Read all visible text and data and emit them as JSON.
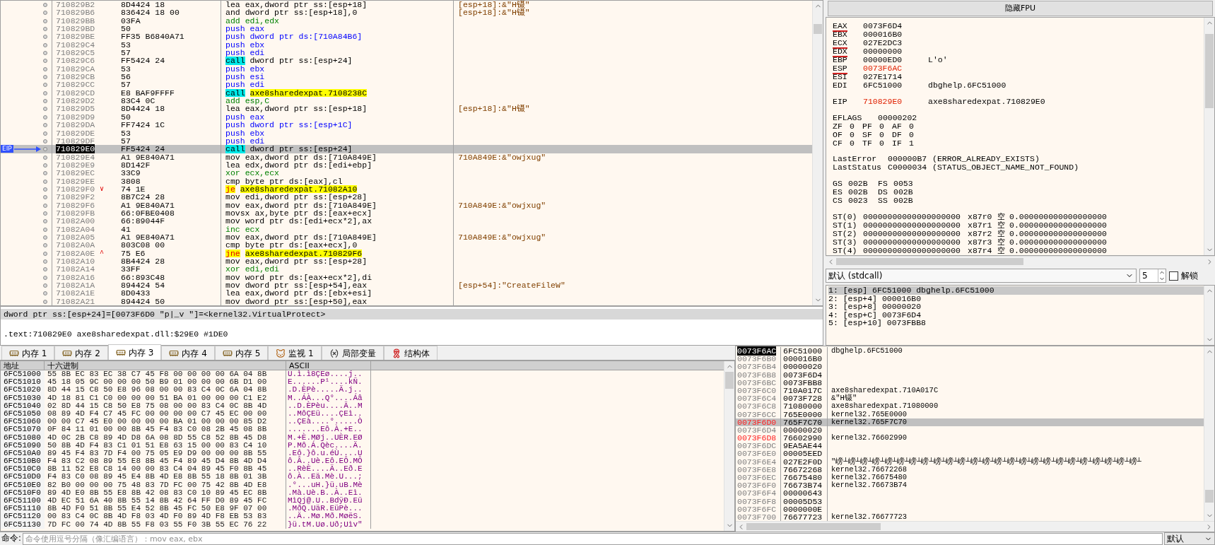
{
  "disassembly": {
    "rows": [
      {
        "address": "710829B2",
        "bytes": "8D4424 18",
        "mnemonic": "lea",
        "operands": "eax,dword ptr ss:[esp+18]",
        "kind": "move",
        "comment": "[esp+18]:&\"H镊\"",
        "selected": false
      },
      {
        "address": "710829B6",
        "bytes": "836424 18 00",
        "mnemonic": "and",
        "operands": "dword ptr ss:[esp+18],0",
        "kind": "move",
        "comment": "[esp+18]:&\"H镊\"",
        "selected": false
      },
      {
        "address": "710829BB",
        "bytes": "03FA",
        "mnemonic": "add",
        "operands": "edi,edx",
        "kind": "arith",
        "selected": false
      },
      {
        "address": "710829BD",
        "bytes": "50",
        "mnemonic": "push",
        "operands": "eax",
        "kind": "push",
        "selected": false
      },
      {
        "address": "710829BE",
        "bytes": "FF35 B6840A71",
        "mnemonic": "push",
        "operands": "dword ptr ds:[710A84B6]",
        "kind": "push",
        "selected": false
      },
      {
        "address": "710829C4",
        "bytes": "53",
        "mnemonic": "push",
        "operands": "ebx",
        "kind": "push",
        "selected": false
      },
      {
        "address": "710829C5",
        "bytes": "57",
        "mnemonic": "push",
        "operands": "edi",
        "kind": "push",
        "selected": false
      },
      {
        "address": "710829C6",
        "bytes": "FF5424 24",
        "mnemonic": "call",
        "operands": "dword ptr ss:[esp+24]",
        "kind": "call",
        "selected": false
      },
      {
        "address": "710829CA",
        "bytes": "53",
        "mnemonic": "push",
        "operands": "ebx",
        "kind": "push",
        "selected": false
      },
      {
        "address": "710829CB",
        "bytes": "56",
        "mnemonic": "push",
        "operands": "esi",
        "kind": "push",
        "selected": false
      },
      {
        "address": "710829CC",
        "bytes": "57",
        "mnemonic": "push",
        "operands": "edi",
        "kind": "push",
        "selected": false
      },
      {
        "address": "710829CD",
        "bytes": "E8 BAF9FFFF",
        "mnemonic": "call",
        "operands": "axe8sharedexpat.7108238C",
        "kind": "call_label",
        "selected": false
      },
      {
        "address": "710829D2",
        "bytes": "83C4 0C",
        "mnemonic": "add",
        "operands": "esp,C",
        "kind": "arith",
        "selected": false
      },
      {
        "address": "710829D5",
        "bytes": "8D4424 18",
        "mnemonic": "lea",
        "operands": "eax,dword ptr ss:[esp+18]",
        "kind": "move",
        "comment": "[esp+18]:&\"H镊\"",
        "selected": false
      },
      {
        "address": "710829D9",
        "bytes": "50",
        "mnemonic": "push",
        "operands": "eax",
        "kind": "push",
        "selected": false
      },
      {
        "address": "710829DA",
        "bytes": "FF7424 1C",
        "mnemonic": "push",
        "operands": "dword ptr ss:[esp+1C]",
        "kind": "push",
        "selected": false
      },
      {
        "address": "710829DE",
        "bytes": "53",
        "mnemonic": "push",
        "operands": "ebx",
        "kind": "push",
        "selected": false
      },
      {
        "address": "710829DF",
        "bytes": "57",
        "mnemonic": "push",
        "operands": "edi",
        "kind": "push",
        "selected": false
      },
      {
        "address": "710829E0",
        "bytes": "FF5424 24",
        "mnemonic": "call",
        "operands": "dword ptr ss:[esp+24]",
        "kind": "call",
        "eip_label": "EIP",
        "selected": true
      },
      {
        "address": "710829E4",
        "bytes": "A1 9E840A71",
        "mnemonic": "mov",
        "operands": "eax,dword ptr ds:[710A849E]",
        "kind": "move",
        "comment": "710A849E:&\"owjxug\"",
        "selected": false
      },
      {
        "address": "710829E9",
        "bytes": "8D142F",
        "mnemonic": "lea",
        "operands": "edx,dword ptr ds:[edi+ebp]",
        "kind": "move",
        "selected": false
      },
      {
        "address": "710829EC",
        "bytes": "33C9",
        "mnemonic": "xor",
        "operands": "ecx,ecx",
        "kind": "arith",
        "selected": false
      },
      {
        "address": "710829EE",
        "bytes": "3808",
        "mnemonic": "cmp",
        "operands": "byte ptr ds:[eax],cl",
        "kind": "move",
        "selected": false
      },
      {
        "address": "710829F0",
        "bytes": "74 1E",
        "mnemonic": "je",
        "operands": "axe8sharedexpat.71082A10",
        "kind": "jump",
        "branch_mark": "∨",
        "selected": false
      },
      {
        "address": "710829F2",
        "bytes": "8B7C24 28",
        "mnemonic": "mov",
        "operands": "edi,dword ptr ss:[esp+28]",
        "kind": "move",
        "selected": false
      },
      {
        "address": "710829F6",
        "bytes": "A1 9E840A71",
        "mnemonic": "mov",
        "operands": "eax,dword ptr ds:[710A849E]",
        "kind": "move",
        "comment": "710A849E:&\"owjxug\"",
        "selected": false
      },
      {
        "address": "710829FB",
        "bytes": "66:0FBE0408",
        "mnemonic": "movsx",
        "operands": "ax,byte ptr ds:[eax+ecx]",
        "kind": "move",
        "selected": false
      },
      {
        "address": "71082A00",
        "bytes": "66:89044F",
        "mnemonic": "mov",
        "operands": "word ptr ds:[edi+ecx*2],ax",
        "kind": "move",
        "selected": false
      },
      {
        "address": "71082A04",
        "bytes": "41",
        "mnemonic": "inc",
        "operands": "ecx",
        "kind": "arith",
        "selected": false
      },
      {
        "address": "71082A05",
        "bytes": "A1 9E840A71",
        "mnemonic": "mov",
        "operands": "eax,dword ptr ds:[710A849E]",
        "kind": "move",
        "comment": "710A849E:&\"owjxug\"",
        "selected": false
      },
      {
        "address": "71082A0A",
        "bytes": "803C08 00",
        "mnemonic": "cmp",
        "operands": "byte ptr ds:[eax+ecx],0",
        "kind": "move",
        "selected": false
      },
      {
        "address": "71082A0E",
        "bytes": "75 E6",
        "mnemonic": "jne",
        "operands": "axe8sharedexpat.710829F6",
        "kind": "jump",
        "branch_mark": "^",
        "selected": false
      },
      {
        "address": "71082A10",
        "bytes": "8B4424 28",
        "mnemonic": "mov",
        "operands": "eax,dword ptr ss:[esp+28]",
        "kind": "move",
        "selected": false
      },
      {
        "address": "71082A14",
        "bytes": "33FF",
        "mnemonic": "xor",
        "operands": "edi,edi",
        "kind": "arith",
        "selected": false
      },
      {
        "address": "71082A16",
        "bytes": "66:893C48",
        "mnemonic": "mov",
        "operands": "word ptr ds:[eax+ecx*2],di",
        "kind": "move",
        "selected": false
      },
      {
        "address": "71082A1A",
        "bytes": "894424 54",
        "mnemonic": "mov",
        "operands": "dword ptr ss:[esp+54],eax",
        "kind": "move",
        "comment": "[esp+54]:\"CreateFileW\"",
        "selected": false
      },
      {
        "address": "71082A1E",
        "bytes": "8D0433",
        "mnemonic": "lea",
        "operands": "eax,dword ptr ds:[ebx+esi]",
        "kind": "move",
        "selected": false
      },
      {
        "address": "71082A21",
        "bytes": "894424 50",
        "mnemonic": "mov",
        "operands": "dword ptr ss:[esp+50],eax",
        "kind": "move",
        "selected": false
      }
    ]
  },
  "info_lines": [
    "dword ptr ss:[esp+24]=[0073F6D0 \"p|_v \"]=<kernel32.VirtualProtect>",
    ".text:710829E0 axe8sharedexpat.dll:$29E0 #1DE0"
  ],
  "registers": {
    "toggle_button": "隐藏FPU",
    "general": [
      {
        "name": "EAX",
        "value": "0073F6D4",
        "accessed": true,
        "changed": false
      },
      {
        "name": "EBX",
        "value": "000016B0",
        "accessed": false,
        "changed": false
      },
      {
        "name": "ECX",
        "value": "027E2DC3",
        "accessed": true,
        "changed": false
      },
      {
        "name": "EDX",
        "value": "00000000",
        "accessed": true,
        "changed": false
      },
      {
        "name": "EBP",
        "value": "00000ED0",
        "comment": "L'o'",
        "accessed": false,
        "changed": false
      },
      {
        "name": "ESP",
        "value": "0073F6AC",
        "accessed": true,
        "changed": true
      },
      {
        "name": "ESI",
        "value": "027E1714",
        "accessed": false,
        "changed": false
      },
      {
        "name": "EDI",
        "value": "6FC51000",
        "comment": "dbghelp.6FC51000",
        "accessed": false,
        "changed": false
      }
    ],
    "eip": {
      "name": "EIP",
      "value": "710829E0",
      "comment": "axe8sharedexpat.710829E0",
      "accessed": false,
      "changed": true
    },
    "eflags": {
      "name": "EFLAGS",
      "value": "00000202"
    },
    "flags": [
      [
        "ZF",
        "0",
        "PF",
        "0",
        "AF",
        "0"
      ],
      [
        "OF",
        "0",
        "SF",
        "0",
        "DF",
        "0"
      ],
      [
        "CF",
        "0",
        "TF",
        "0",
        "IF",
        "1"
      ]
    ],
    "errors": [
      {
        "name": "LastError",
        "value": "000000B7",
        "description": "(ERROR_ALREADY_EXISTS)"
      },
      {
        "name": "LastStatus",
        "value": "C0000034",
        "description": "(STATUS_OBJECT_NAME_NOT_FOUND)"
      }
    ],
    "segments": [
      [
        "GS",
        "002B",
        "FS",
        "0053"
      ],
      [
        "ES",
        "002B",
        "DS",
        "002B"
      ],
      [
        "CS",
        "0023",
        "SS",
        "002B"
      ]
    ],
    "fpu": [
      {
        "name": "ST(0)",
        "raw": "00000000000000000000",
        "tag_reg": "x87r0",
        "tag": "空",
        "value": "0.000000000000000000"
      },
      {
        "name": "ST(1)",
        "raw": "00000000000000000000",
        "tag_reg": "x87r1",
        "tag": "空",
        "value": "0.000000000000000000"
      },
      {
        "name": "ST(2)",
        "raw": "00000000000000000000",
        "tag_reg": "x87r2",
        "tag": "空",
        "value": "0.000000000000000000"
      },
      {
        "name": "ST(3)",
        "raw": "00000000000000000000",
        "tag_reg": "x87r3",
        "tag": "空",
        "value": "0.000000000000000000"
      },
      {
        "name": "ST(4)",
        "raw": "00000000000000000000",
        "tag_reg": "x87r4",
        "tag": "空",
        "value": "0.000000000000000000"
      }
    ]
  },
  "call_convention": {
    "value": "默认 (stdcall)",
    "count": "5",
    "unlock_label": "解锁",
    "unlocked": false
  },
  "arguments": [
    {
      "text": "1: [esp] 6FC51000 dbghelp.6FC51000",
      "selected": true
    },
    {
      "text": "2: [esp+4] 000016B0",
      "selected": false
    },
    {
      "text": "3: [esp+8] 00000020",
      "selected": false
    },
    {
      "text": "4: [esp+C] 0073F6D4",
      "selected": false
    },
    {
      "text": "5: [esp+10] 0073FBB8",
      "selected": false
    }
  ],
  "dump_tabs": [
    {
      "label": "内存 1",
      "kind": "memory",
      "selected": false
    },
    {
      "label": "内存 2",
      "kind": "memory",
      "selected": false
    },
    {
      "label": "内存 3",
      "kind": "memory",
      "selected": true
    },
    {
      "label": "内存 4",
      "kind": "memory",
      "selected": false
    },
    {
      "label": "内存 5",
      "kind": "memory",
      "selected": false
    },
    {
      "label": "监视 1",
      "kind": "watch",
      "selected": false
    },
    {
      "label": "局部变量",
      "kind": "variable",
      "selected": false
    },
    {
      "label": "结构体",
      "kind": "struct",
      "selected": false
    }
  ],
  "dump": {
    "columns": [
      "地址",
      "十六进制",
      "ASCII"
    ],
    "rows": [
      {
        "address": "6FC51000",
        "hex": "55 8B EC 83 EC 38 C7 45 F8 00 00 00 00 6A 04 8B",
        "ascii": "U.ì.ì8ÇEø....j.."
      },
      {
        "address": "6FC51010",
        "hex": "45 18 05 9C 00 00 00 50 B9 01 00 00 00 6B D1 00",
        "ascii": "E......P¹....kÑ."
      },
      {
        "address": "6FC51020",
        "hex": "8D 44 15 C8 50 E8 96 08 00 00 83 C4 0C 6A 04 8B",
        "ascii": ".D.ÈPè.....Ä.j.."
      },
      {
        "address": "6FC51030",
        "hex": "4D 18 81 C1 C0 00 00 00 51 BA 01 00 00 00 C1 E2",
        "ascii": "M..ÁÀ...Q°....Áâ"
      },
      {
        "address": "6FC51040",
        "hex": "02 8D 44 15 C8 50 E8 75 08 00 00 83 C4 0C 8B 4D",
        "ascii": "..D.ÈPèu....Ä..M"
      },
      {
        "address": "6FC51050",
        "hex": "08 89 4D F4 C7 45 FC 00 00 00 00 C7 45 EC 00 00",
        "ascii": "..MôÇEü....ÇEì.."
      },
      {
        "address": "6FC51060",
        "hex": "00 00 C7 45 E0 00 00 00 00 BA 01 00 00 00 85 D2",
        "ascii": "..ÇEà....°.....Ò"
      },
      {
        "address": "6FC51070",
        "hex": "0F 84 11 01 00 00 8B 45 F4 83 C0 08 2B 45 08 8B",
        "ascii": ".......Eô.À.+E.."
      },
      {
        "address": "6FC51080",
        "hex": "4D 0C 2B C8 89 4D D8 6A 08 8D 55 C8 52 8B 45 D8",
        "ascii": "M.+È.MØj..UÈR.EØ"
      },
      {
        "address": "6FC51090",
        "hex": "50 8B 4D F4 83 C1 01 51 E8 63 15 00 00 83 C4 10",
        "ascii": "P.Mô.Á.Qèc....Ä."
      },
      {
        "address": "6FC510A0",
        "hex": "89 45 F4 83 7D F4 00 75 05 E9 D9 00 00 00 8B 55",
        "ascii": ".Eô.}ô.u.éÙ....U"
      },
      {
        "address": "6FC510B0",
        "hex": "F4 83 C2 08 89 55 E8 8B 45 F4 89 45 D4 8B 4D D4",
        "ascii": "ô.Â..Uè.Eô.EÔ.MÔ"
      },
      {
        "address": "6FC510C0",
        "hex": "8B 11 52 E8 C8 14 00 00 83 C4 04 89 45 F0 8B 45",
        "ascii": "..RèÈ....Ä..Eð.E"
      },
      {
        "address": "6FC510D0",
        "hex": "F4 83 C0 08 89 45 E4 8B 4D E8 8B 55 18 8B 01 3B",
        "ascii": "ô.À..Eä.Mè.U...;"
      },
      {
        "address": "6FC510E0",
        "hex": "82 B0 00 00 00 75 48 83 7D FC 00 75 42 8B 4D E8",
        "ascii": ".°...uH.}ü.uB.Mè"
      },
      {
        "address": "6FC510F0",
        "hex": "89 4D E0 8B 55 E8 8B 42 08 83 C0 10 89 45 EC 8B",
        "ascii": ".Mà.Uè.B..À..Eì."
      },
      {
        "address": "6FC51100",
        "hex": "4D EC 51 6A 40 8B 55 14 8B 42 64 FF D0 89 45 FC",
        "ascii": "MìQj@.U..BdÿÐ.Eü"
      },
      {
        "address": "6FC51110",
        "hex": "8B 4D F0 51 8B 55 E4 52 8B 45 FC 50 E8 9F 07 00",
        "ascii": ".MðQ.UäR.EüPè..."
      },
      {
        "address": "6FC51120",
        "hex": "00 83 C4 0C 8B 4D F8 03 4D F0 89 4D F8 EB 53 83",
        "ascii": "..Ä..Mø.Mð.MøëS."
      },
      {
        "address": "6FC51130",
        "hex": "7D FC 00 74 4D 8B 55 F8 03 55 F0 3B 55 EC 76 22",
        "ascii": "}ü.tM.Uø.Uð;Uìv\""
      }
    ]
  },
  "stack": [
    {
      "address": "0073F6AC",
      "value": "6FC51000",
      "comment": "dbghelp.6FC51000",
      "top": true,
      "selected": false,
      "marked": false
    },
    {
      "address": "0073F6B0",
      "value": "000016B0",
      "top": false,
      "selected": false,
      "marked": false
    },
    {
      "address": "0073F6B4",
      "value": "00000020",
      "top": false,
      "selected": false,
      "marked": false
    },
    {
      "address": "0073F6B8",
      "value": "0073F6D4",
      "top": false,
      "selected": false,
      "marked": false
    },
    {
      "address": "0073F6BC",
      "value": "0073FBB8",
      "top": false,
      "selected": false,
      "marked": false
    },
    {
      "address": "0073F6C0",
      "value": "710A017C",
      "comment": "axe8sharedexpat.710A017C",
      "top": false,
      "selected": false,
      "marked": false
    },
    {
      "address": "0073F6C4",
      "value": "0073F728",
      "comment": "&\"H镊\"",
      "top": false,
      "selected": false,
      "marked": false
    },
    {
      "address": "0073F6C8",
      "value": "71080000",
      "comment": "axe8sharedexpat.71080000",
      "top": false,
      "selected": false,
      "marked": false
    },
    {
      "address": "0073F6CC",
      "value": "765E0000",
      "comment": "kernel32.765E0000",
      "top": false,
      "selected": false,
      "marked": false
    },
    {
      "address": "0073F6D0",
      "value": "765F7C70",
      "comment": "kernel32.765F7C70",
      "top": false,
      "selected": true,
      "marked": true
    },
    {
      "address": "0073F6D4",
      "value": "00000020",
      "top": false,
      "selected": false,
      "marked": false
    },
    {
      "address": "0073F6D8",
      "value": "76602990",
      "comment": "kernel32.76602990",
      "top": false,
      "selected": false,
      "marked": true
    },
    {
      "address": "0073F6DC",
      "value": "9EA5AE44",
      "top": false,
      "selected": false,
      "marked": false
    },
    {
      "address": "0073F6E0",
      "value": "00005EED",
      "top": false,
      "selected": false,
      "marked": false
    },
    {
      "address": "0073F6E4",
      "value": "027E2F0D",
      "comment": "\"嵭┴嵭┴嵭┴嵭┴嵭┴嵭┴嵭┴嵭┴嵭┴嵭┴嵭┴嵭┴嵭┴嵭┴嵭┴嵭┴嵭┴嵭┴嵭┴嵭┴嵭┴嵭┴嵭┴嵭┴嵭┴",
      "top": false,
      "selected": false,
      "marked": false
    },
    {
      "address": "0073F6E8",
      "value": "76672268",
      "comment": "kernel32.76672268",
      "top": false,
      "selected": false,
      "marked": false
    },
    {
      "address": "0073F6EC",
      "value": "76675480",
      "comment": "kernel32.76675480",
      "top": false,
      "selected": false,
      "marked": false
    },
    {
      "address": "0073F6F0",
      "value": "76673B74",
      "comment": "kernel32.76673B74",
      "top": false,
      "selected": false,
      "marked": false
    },
    {
      "address": "0073F6F4",
      "value": "00000643",
      "top": false,
      "selected": false,
      "marked": false
    },
    {
      "address": "0073F6F8",
      "value": "00005D53",
      "top": false,
      "selected": false,
      "marked": false
    },
    {
      "address": "0073F6FC",
      "value": "0000000E",
      "top": false,
      "selected": false,
      "marked": false
    },
    {
      "address": "0073F700",
      "value": "76677723",
      "comment": "kernel32.76677723",
      "top": false,
      "selected": false,
      "marked": false
    }
  ],
  "command": {
    "label": "命令:",
    "placeholder": "命令使用逗号分隔（像汇编语言）：mov eax, ebx",
    "mode": "默认"
  }
}
